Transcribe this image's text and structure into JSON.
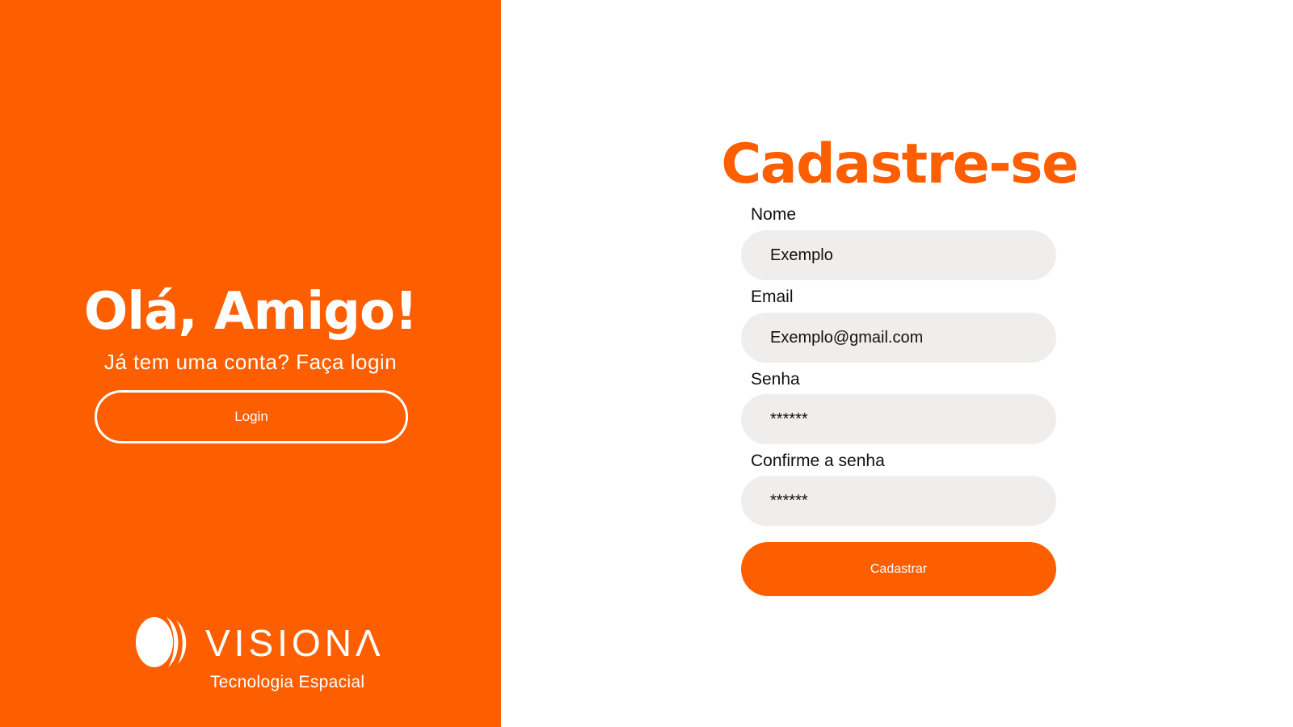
{
  "colors": {
    "accent": "#FC5E00",
    "input_bg": "#F0EEEC",
    "text": "#111111",
    "white": "#FFFFFF"
  },
  "left": {
    "title": "Olá, Amigo!",
    "subtitle": "Já tem uma conta? Faça login",
    "login_label": "Login",
    "logo": {
      "icon": "visiona-logo-icon",
      "wordmark": "VISIONΛ",
      "tagline": "Tecnologia Espacial"
    }
  },
  "form": {
    "title": "Cadastre-se",
    "fields": [
      {
        "label": "Nome",
        "value": "Exemplo"
      },
      {
        "label": "Email",
        "value": "Exemplo@gmail.com"
      },
      {
        "label": "Senha",
        "value": "******"
      },
      {
        "label": "Confirme a senha",
        "value": "******"
      }
    ],
    "submit_label": "Cadastrar"
  }
}
